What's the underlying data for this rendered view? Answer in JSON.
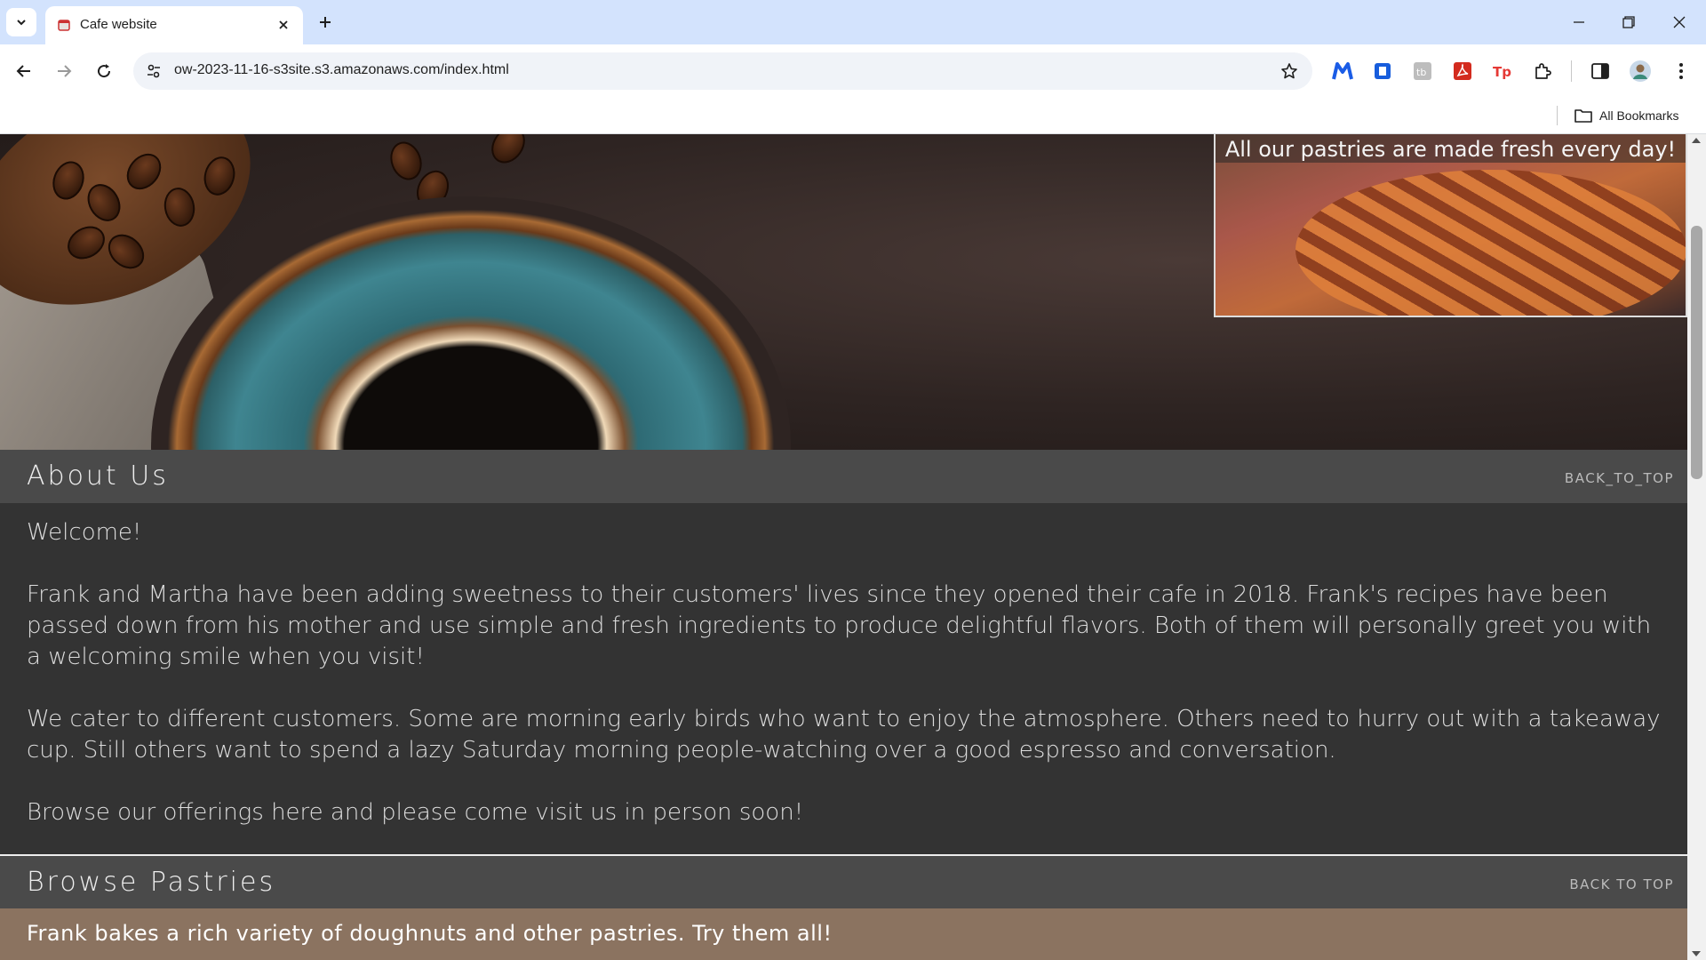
{
  "browser": {
    "tab_title": "Cafe website",
    "url": "ow-2023-11-16-s3site.s3.amazonaws.com/index.html",
    "bookmarks_label": "All Bookmarks"
  },
  "hero": {
    "pastry_caption": "All our pastries are made fresh every day!"
  },
  "about": {
    "title": "About Us",
    "back_to_top": "BACK_TO_TOP",
    "paragraphs": [
      "Welcome!",
      "Frank and Martha have been adding sweetness to their customers' lives since they opened their cafe in 2018. Frank's recipes have been passed down from his mother and use simple and fresh ingredients to produce delightful flavors. Both of them will personally greet you with a welcoming smile when you visit!",
      "We cater to different customers. Some are morning early birds who want to enjoy the atmosphere. Others need to hurry out with a takeaway cup. Still others want to spend a lazy Saturday morning people-watching over a good espresso and conversation.",
      "Browse our offerings here and please come visit us in person soon!"
    ]
  },
  "pastries": {
    "title": "Browse Pastries",
    "back_to_top": "BACK TO TOP",
    "intro": "Frank bakes a rich variety of doughnuts and other pastries. Try them all!"
  },
  "colors": {
    "tabbar_bg": "#d3e3fd",
    "section_header_bg": "#4a4a4a",
    "page_bg": "#333333",
    "pastries_intro_bg": "#8b7360"
  }
}
